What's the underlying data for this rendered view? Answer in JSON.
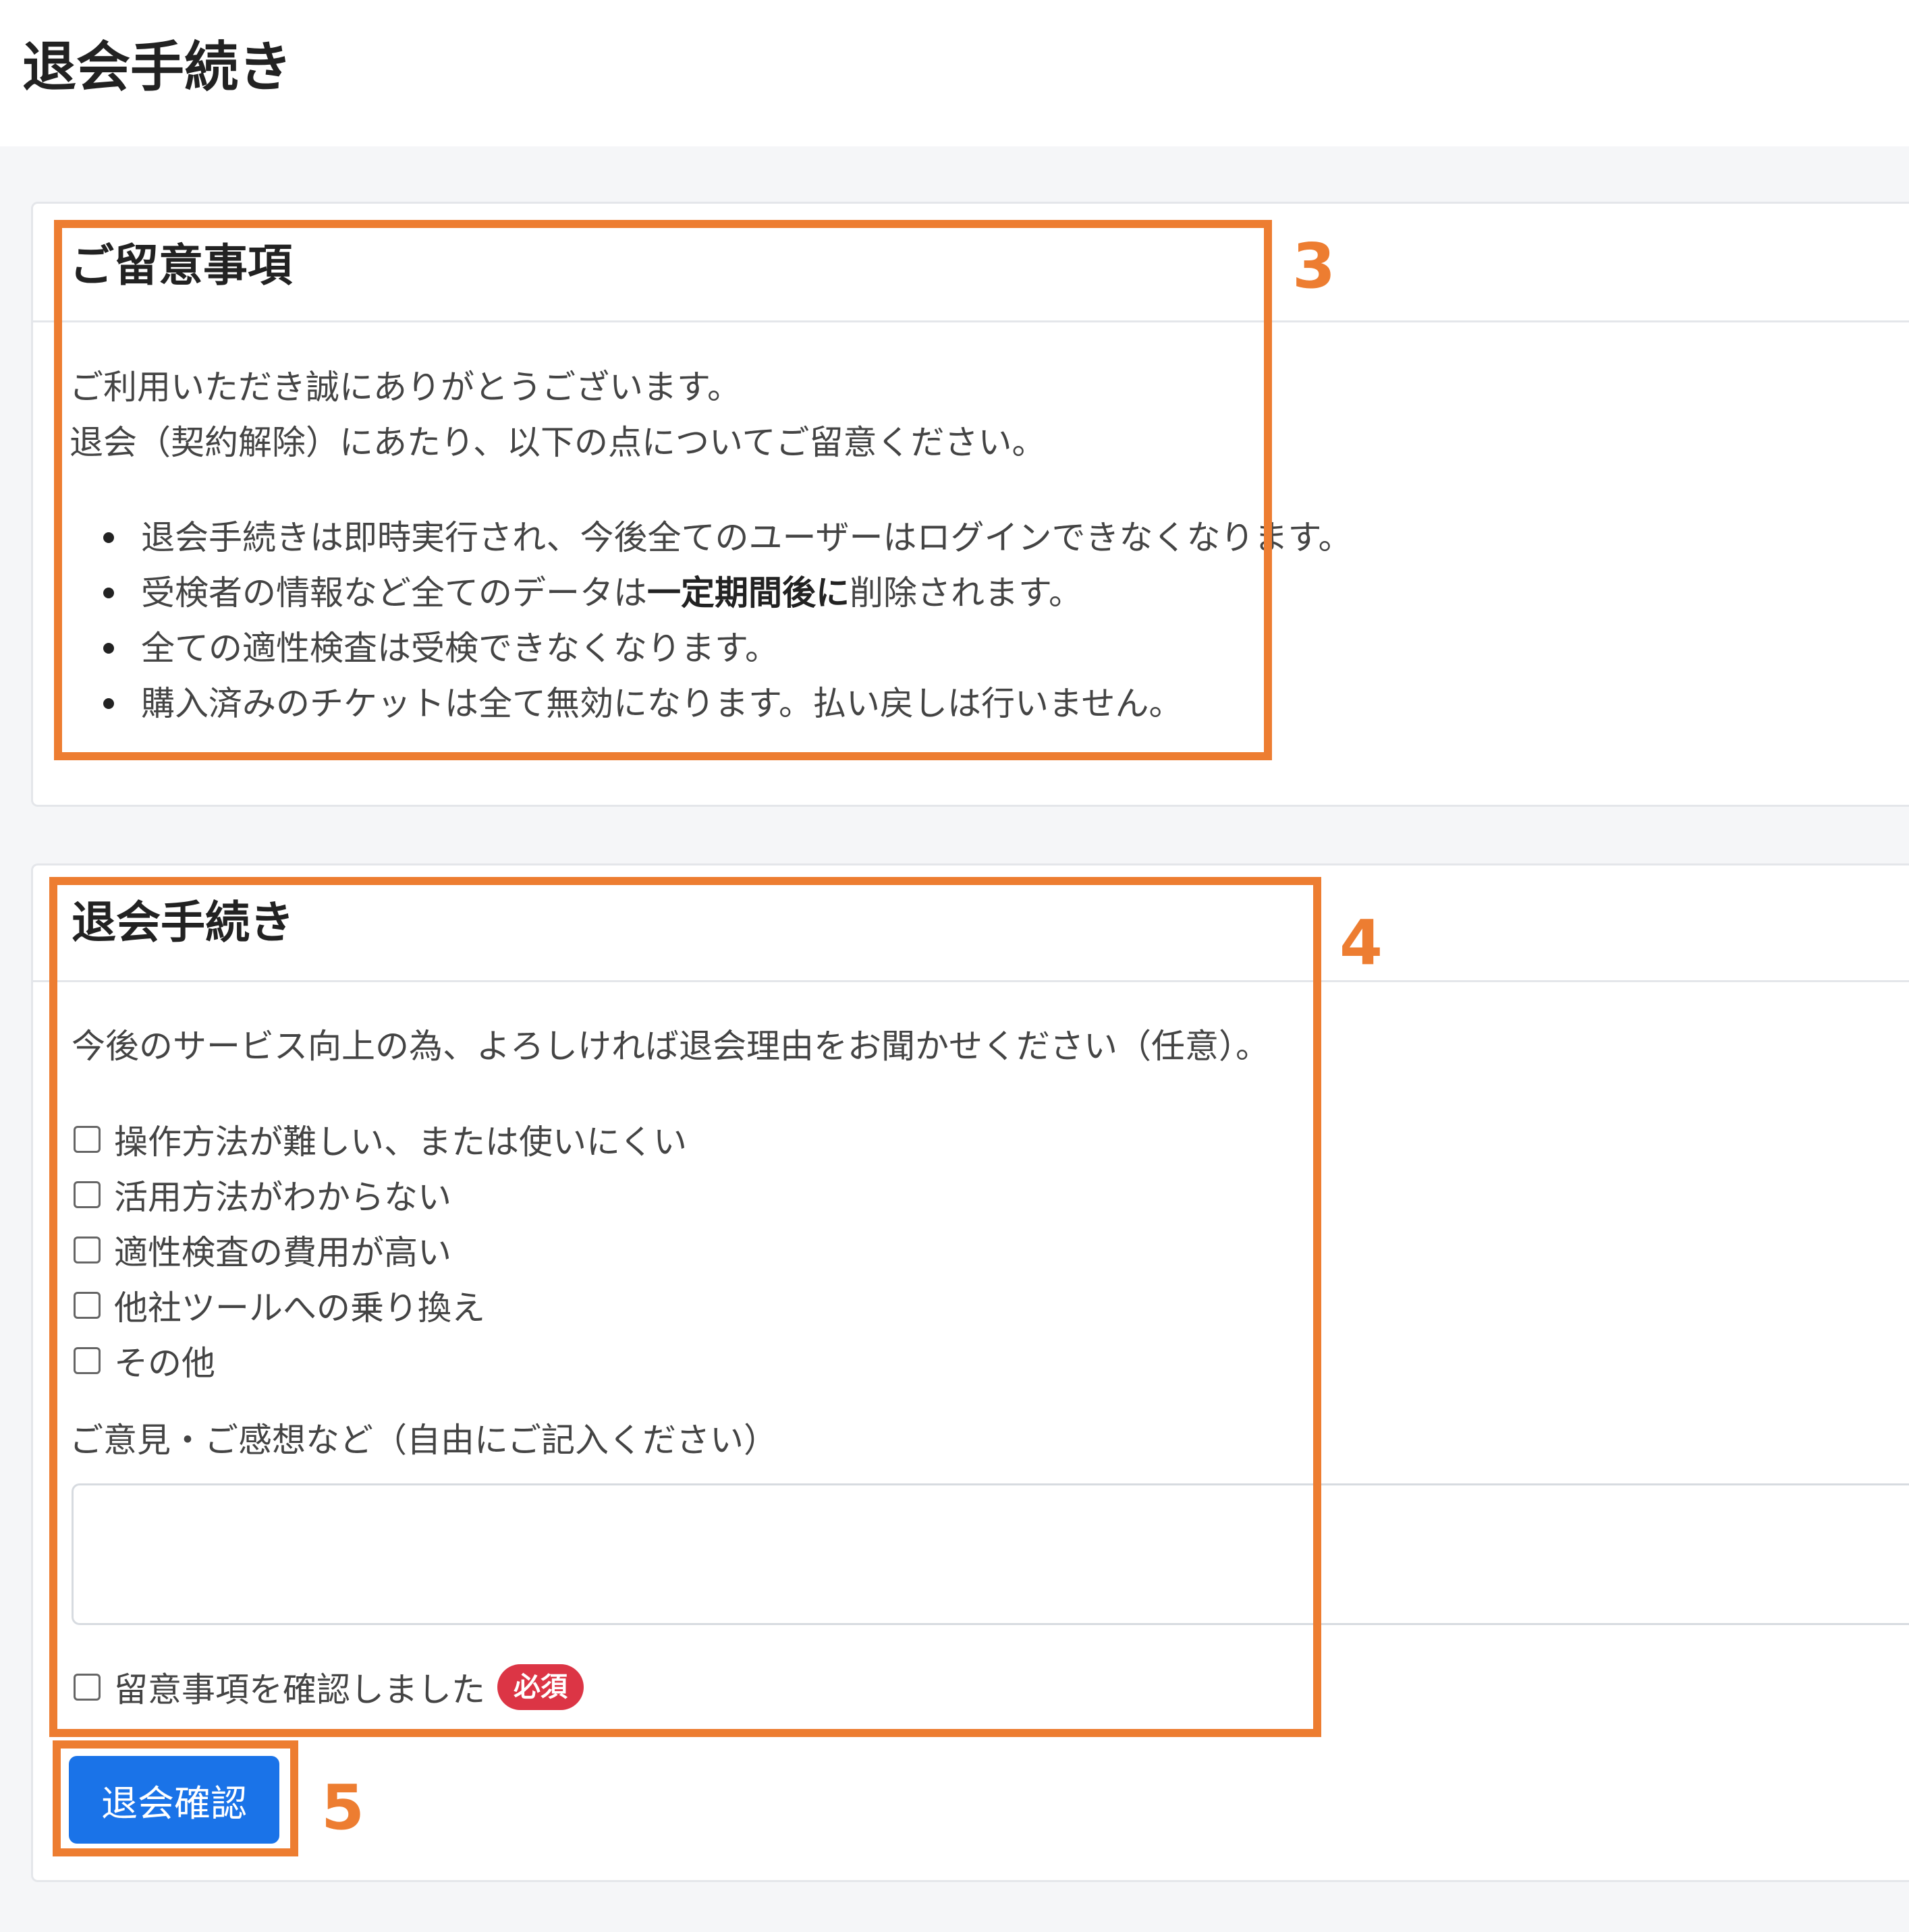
{
  "page": {
    "title": "退会手続き"
  },
  "notice": {
    "title": "ご留意事項",
    "intro_lines": [
      "ご利用いただき誠にありがとうございます。",
      "退会（契約解除）にあたり、以下の点についてご留意ください。"
    ],
    "items": [
      "退会手続きは即時実行され、今後全てのユーザーはログインできなくなります。",
      {
        "before": "受検者の情報など全てのデータは",
        "bold": "一定期間後に",
        "after": "削除されます。"
      },
      "全ての適性検査は受検できなくなります。",
      "購入済みのチケットは全て無効になります。払い戻しは行いません。"
    ]
  },
  "withdraw": {
    "title": "退会手続き",
    "reason_prompt": "今後のサービス向上の為、よろしければ退会理由をお聞かせください（任意）。",
    "reasons": [
      "操作方法が難しい、または使いにくい",
      "活用方法がわからない",
      "適性検査の費用が高い",
      "他社ツールへの乗り換え",
      "その他"
    ],
    "comment_label": "ご意見・ご感想など（自由にご記入ください）",
    "comment_value": "",
    "confirm_label": "留意事項を確認しました",
    "required_badge": "必須",
    "submit_label": "退会確認"
  },
  "annotations": [
    "3",
    "4",
    "5"
  ],
  "colors": {
    "annotation": "#ed7d31",
    "primary": "#1a73e8",
    "required": "#dc3545"
  }
}
